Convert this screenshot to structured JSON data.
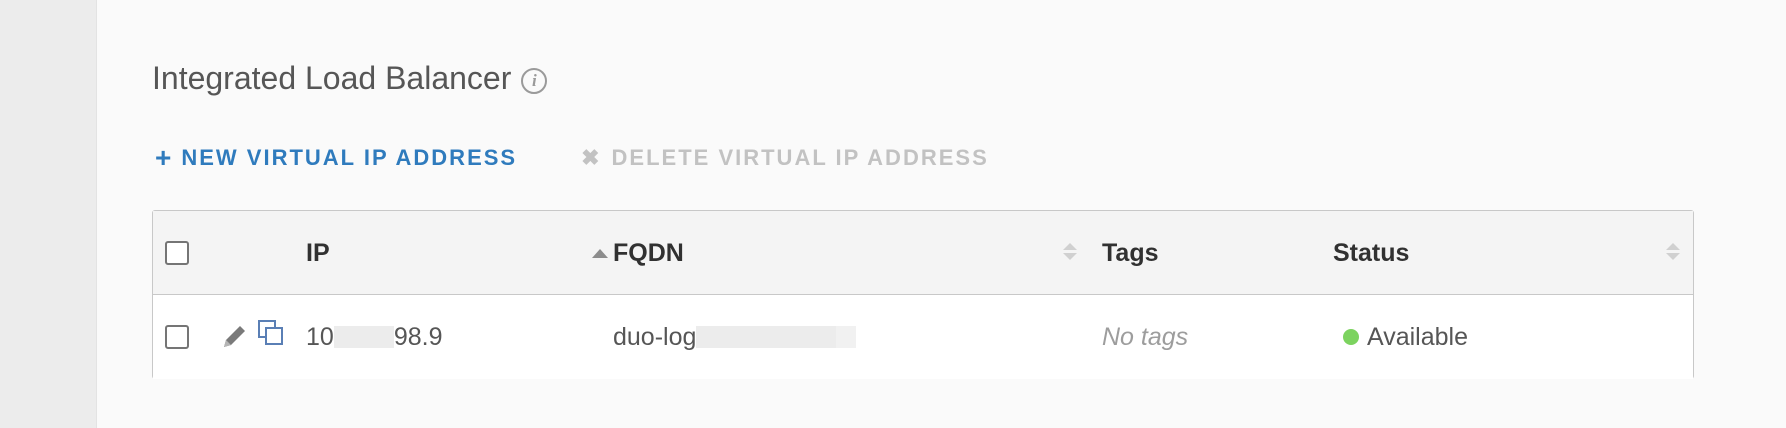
{
  "section": {
    "title": "Integrated Load Balancer",
    "info_icon": "info-icon"
  },
  "toolbar": {
    "new_glyph": "+",
    "new_label": "NEW VIRTUAL IP ADDRESS",
    "delete_glyph": "✖",
    "delete_label": "DELETE VIRTUAL IP ADDRESS"
  },
  "table": {
    "columns": [
      "IP",
      "FQDN",
      "Tags",
      "Status"
    ],
    "sorted_column": "IP",
    "sort_direction": "ascending",
    "rows": [
      {
        "ip_prefix": "10",
        "ip_suffix": "98.9",
        "fqdn_prefix": "duo-log",
        "tags": "No tags",
        "status": "Available",
        "status_color": "#7cd35f"
      }
    ]
  },
  "colors": {
    "accent": "#2f7bbd",
    "disabled": "#c2c2c2",
    "available": "#7cd35f"
  }
}
